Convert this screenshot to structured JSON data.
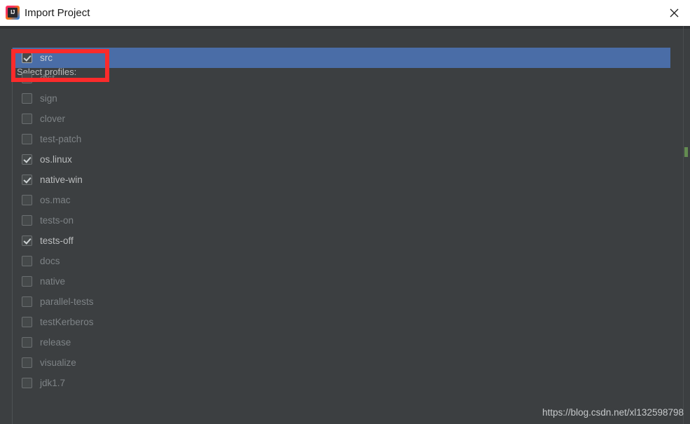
{
  "window": {
    "title": "Import Project",
    "icon": "intellij-idea-icon",
    "icon_text": "IJ",
    "close_label": "✕"
  },
  "dialog": {
    "section_label": "Select profiles:"
  },
  "profiles": [
    {
      "label": "src",
      "checked": true,
      "selected": true
    },
    {
      "label": "dist",
      "checked": false,
      "selected": false
    },
    {
      "label": "sign",
      "checked": false,
      "selected": false
    },
    {
      "label": "clover",
      "checked": false,
      "selected": false
    },
    {
      "label": "test-patch",
      "checked": false,
      "selected": false
    },
    {
      "label": "os.linux",
      "checked": true,
      "selected": false
    },
    {
      "label": "native-win",
      "checked": true,
      "selected": false
    },
    {
      "label": "os.mac",
      "checked": false,
      "selected": false
    },
    {
      "label": "tests-on",
      "checked": false,
      "selected": false
    },
    {
      "label": "tests-off",
      "checked": true,
      "selected": false
    },
    {
      "label": "docs",
      "checked": false,
      "selected": false
    },
    {
      "label": "native",
      "checked": false,
      "selected": false
    },
    {
      "label": "parallel-tests",
      "checked": false,
      "selected": false
    },
    {
      "label": "testKerberos",
      "checked": false,
      "selected": false
    },
    {
      "label": "release",
      "checked": false,
      "selected": false
    },
    {
      "label": "visualize",
      "checked": false,
      "selected": false
    },
    {
      "label": "jdk1.7",
      "checked": false,
      "selected": false
    }
  ],
  "annotation": {
    "type": "highlight-rectangle",
    "color": "#fb2b2b",
    "target": "src"
  },
  "watermark": {
    "text": "https://blog.csdn.net/xl132598798"
  },
  "colors": {
    "titlebar_bg": "#ffffff",
    "dialog_bg": "#3c3f41",
    "selection_blue": "#4a6da7",
    "label_text": "#bbbbbb",
    "item_text_off": "#7e8386",
    "item_text_on": "#bbbdbe",
    "annotation_red": "#fb2b2b",
    "scroll_marker_green": "#6a9955"
  }
}
